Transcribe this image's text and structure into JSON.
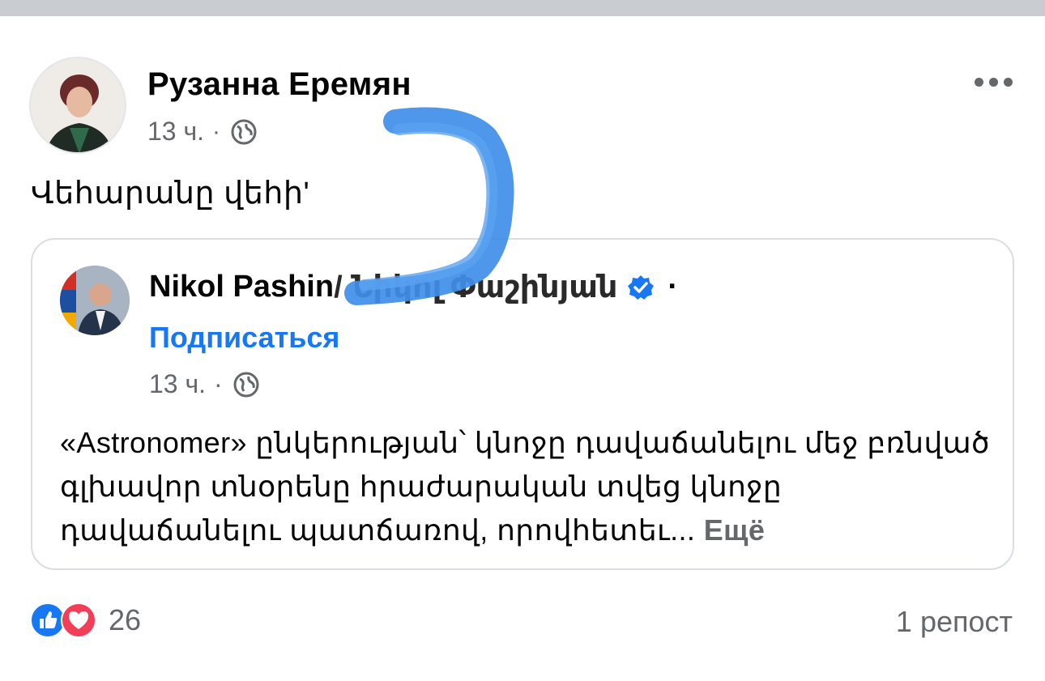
{
  "post": {
    "author": "Рузанна Еремян",
    "time": "13 ч.",
    "separator": "·",
    "text": "Վեհարանը վեհի'"
  },
  "shared": {
    "name_part1": "Nikol Pashin",
    "name_part2": "/ Նիկոլ Փաշինյան",
    "separator": "·",
    "follow": "Подписаться",
    "time": "13 ч.",
    "body": "«Astronomer» ընկերության՝ կնոջը դավաճանելու մեջ բռնված գլխավոր տնօրենը հրաժարական տվեց կնոջը դավաճանելու պատճառով, որովհետեւ...",
    "more": "Ещё"
  },
  "footer": {
    "reaction_count": "26",
    "shares": "1 репост"
  },
  "colors": {
    "link_blue": "#1877f2",
    "meta_gray": "#65676b",
    "scribble_blue": "#3f8ee8"
  },
  "icons": [
    "globe-icon",
    "more-icon",
    "verified-badge-icon",
    "like-icon",
    "love-icon"
  ]
}
